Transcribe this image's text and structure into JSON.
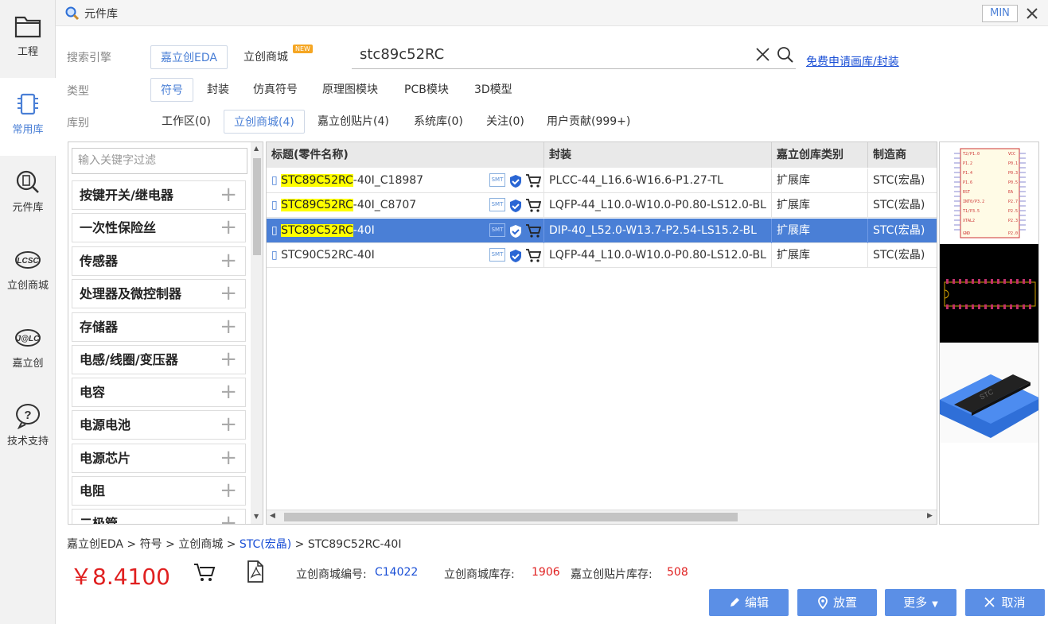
{
  "window": {
    "title": "元件库",
    "min_label": "MIN"
  },
  "sidebar": {
    "items": [
      {
        "label": "工程",
        "icon": "folder-icon"
      },
      {
        "label": "常用库",
        "icon": "chip-icon"
      },
      {
        "label": "元件库",
        "icon": "chip-search-icon"
      },
      {
        "label": "立创商城",
        "icon": "lcsc-logo-icon"
      },
      {
        "label": "嘉立创",
        "icon": "jlc-logo-icon"
      },
      {
        "label": "技术支持",
        "icon": "question-icon"
      }
    ]
  },
  "search": {
    "engine_label": "搜索引擎",
    "engines": [
      "嘉立创EDA",
      "立创商城"
    ],
    "new_badge": "NEW",
    "query": "stc89c52RC",
    "apply_link": "免费申请画库/封装"
  },
  "type_filter": {
    "label": "类型",
    "options": [
      "符号",
      "封装",
      "仿真符号",
      "原理图模块",
      "PCB模块",
      "3D模型"
    ]
  },
  "lib_filter": {
    "label": "库别",
    "options": [
      "工作区(0)",
      "立创商城(4)",
      "嘉立创贴片(4)",
      "系统库(0)",
      "关注(0)",
      "用户贡献(999+)"
    ]
  },
  "categories": {
    "filter_placeholder": "输入关键字过滤",
    "items": [
      "按键开关/继电器",
      "一次性保险丝",
      "传感器",
      "处理器及微控制器",
      "存储器",
      "电感/线圈/变压器",
      "电容",
      "电源电池",
      "电源芯片",
      "电阻",
      "二极管"
    ]
  },
  "table": {
    "headers": [
      "标题(零件名称)",
      "封装",
      "嘉立创库类别",
      "制造商"
    ],
    "smt_label": "SMT",
    "rows": [
      {
        "hl": "STC89C52RC",
        "rest": "-40I_C18987",
        "package": "PLCC-44_L16.6-W16.6-P1.27-TL",
        "lib_type": "扩展库",
        "mfr": "STC(宏晶)"
      },
      {
        "hl": "STC89C52RC",
        "rest": "-40I_C8707",
        "package": "LQFP-44_L10.0-W10.0-P0.80-LS12.0-BL",
        "lib_type": "扩展库",
        "mfr": "STC(宏晶)"
      },
      {
        "hl": "STC89C52RC",
        "rest": "-40I",
        "package": "DIP-40_L52.0-W13.7-P2.54-LS15.2-BL",
        "lib_type": "扩展库",
        "mfr": "STC(宏晶)"
      },
      {
        "hl": "",
        "rest": "STC90C52RC-40I",
        "package": "LQFP-44_L10.0-W10.0-P0.80-LS12.0-BL",
        "lib_type": "扩展库",
        "mfr": "STC(宏晶)"
      }
    ]
  },
  "breadcrumb": {
    "parts": [
      "嘉立创EDA",
      "符号",
      "立创商城"
    ],
    "link": "STC(宏晶)",
    "last": "STC89C52RC-40I",
    "sep": ">"
  },
  "footer": {
    "price": "￥8.4100",
    "code_label": "立创商城编号:",
    "code": "C14022",
    "stock_label": "立创商城库存:",
    "stock": "1906",
    "smt_stock_label": "嘉立创贴片库存:",
    "smt_stock": "508"
  },
  "buttons": {
    "edit": "编辑",
    "place": "放置",
    "more": "更多",
    "cancel": "取消"
  },
  "colors": {
    "accent": "#4a7fd6",
    "button": "#5b8fe6",
    "price": "#e02020",
    "highlight": "#ffff00"
  }
}
